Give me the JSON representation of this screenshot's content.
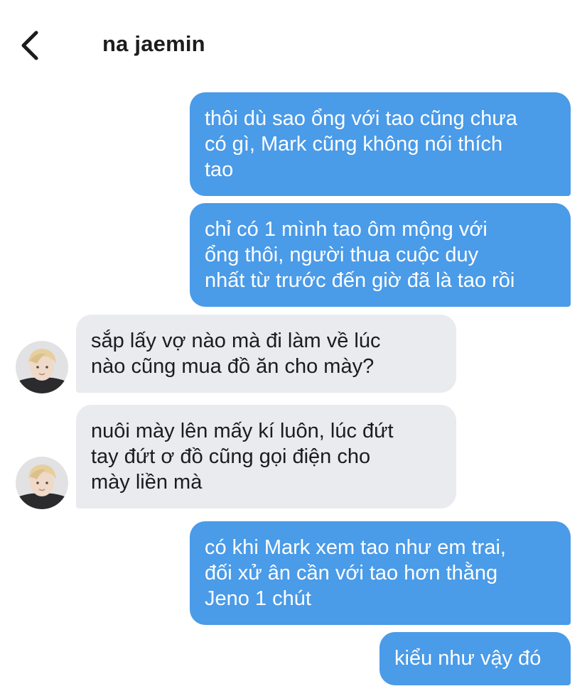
{
  "header": {
    "contact_name": "na jaemin",
    "back_icon": "chevron-left-icon"
  },
  "colors": {
    "outgoing_bubble": "#4a9be8",
    "incoming_bubble": "#e9ebee",
    "outgoing_text": "#ffffff",
    "incoming_text": "#1c1c1e"
  },
  "messages": [
    {
      "direction": "outgoing",
      "text": "thôi dù sao ổng với tao cũng chưa\ncó gì, Mark cũng không nói thích\ntao"
    },
    {
      "direction": "outgoing",
      "text": "chỉ có 1 mình tao ôm mộng với\nổng thôi, người thua cuộc duy\nnhất từ trước đến giờ đã là tao rồi"
    },
    {
      "direction": "incoming",
      "text": "sắp lấy vợ nào mà đi làm về lúc\nnào cũng mua đồ ăn cho mày?"
    },
    {
      "direction": "incoming",
      "text": "nuôi mày lên mấy kí luôn, lúc đứt\ntay đứt ơ đồ cũng gọi điện cho\nmày liền mà"
    },
    {
      "direction": "outgoing",
      "text": "có khi Mark xem tao như em trai,\nđối xử ân cần với tao hơn thằng\nJeno 1 chút"
    },
    {
      "direction": "outgoing",
      "text": "kiểu như vậy đó"
    }
  ]
}
